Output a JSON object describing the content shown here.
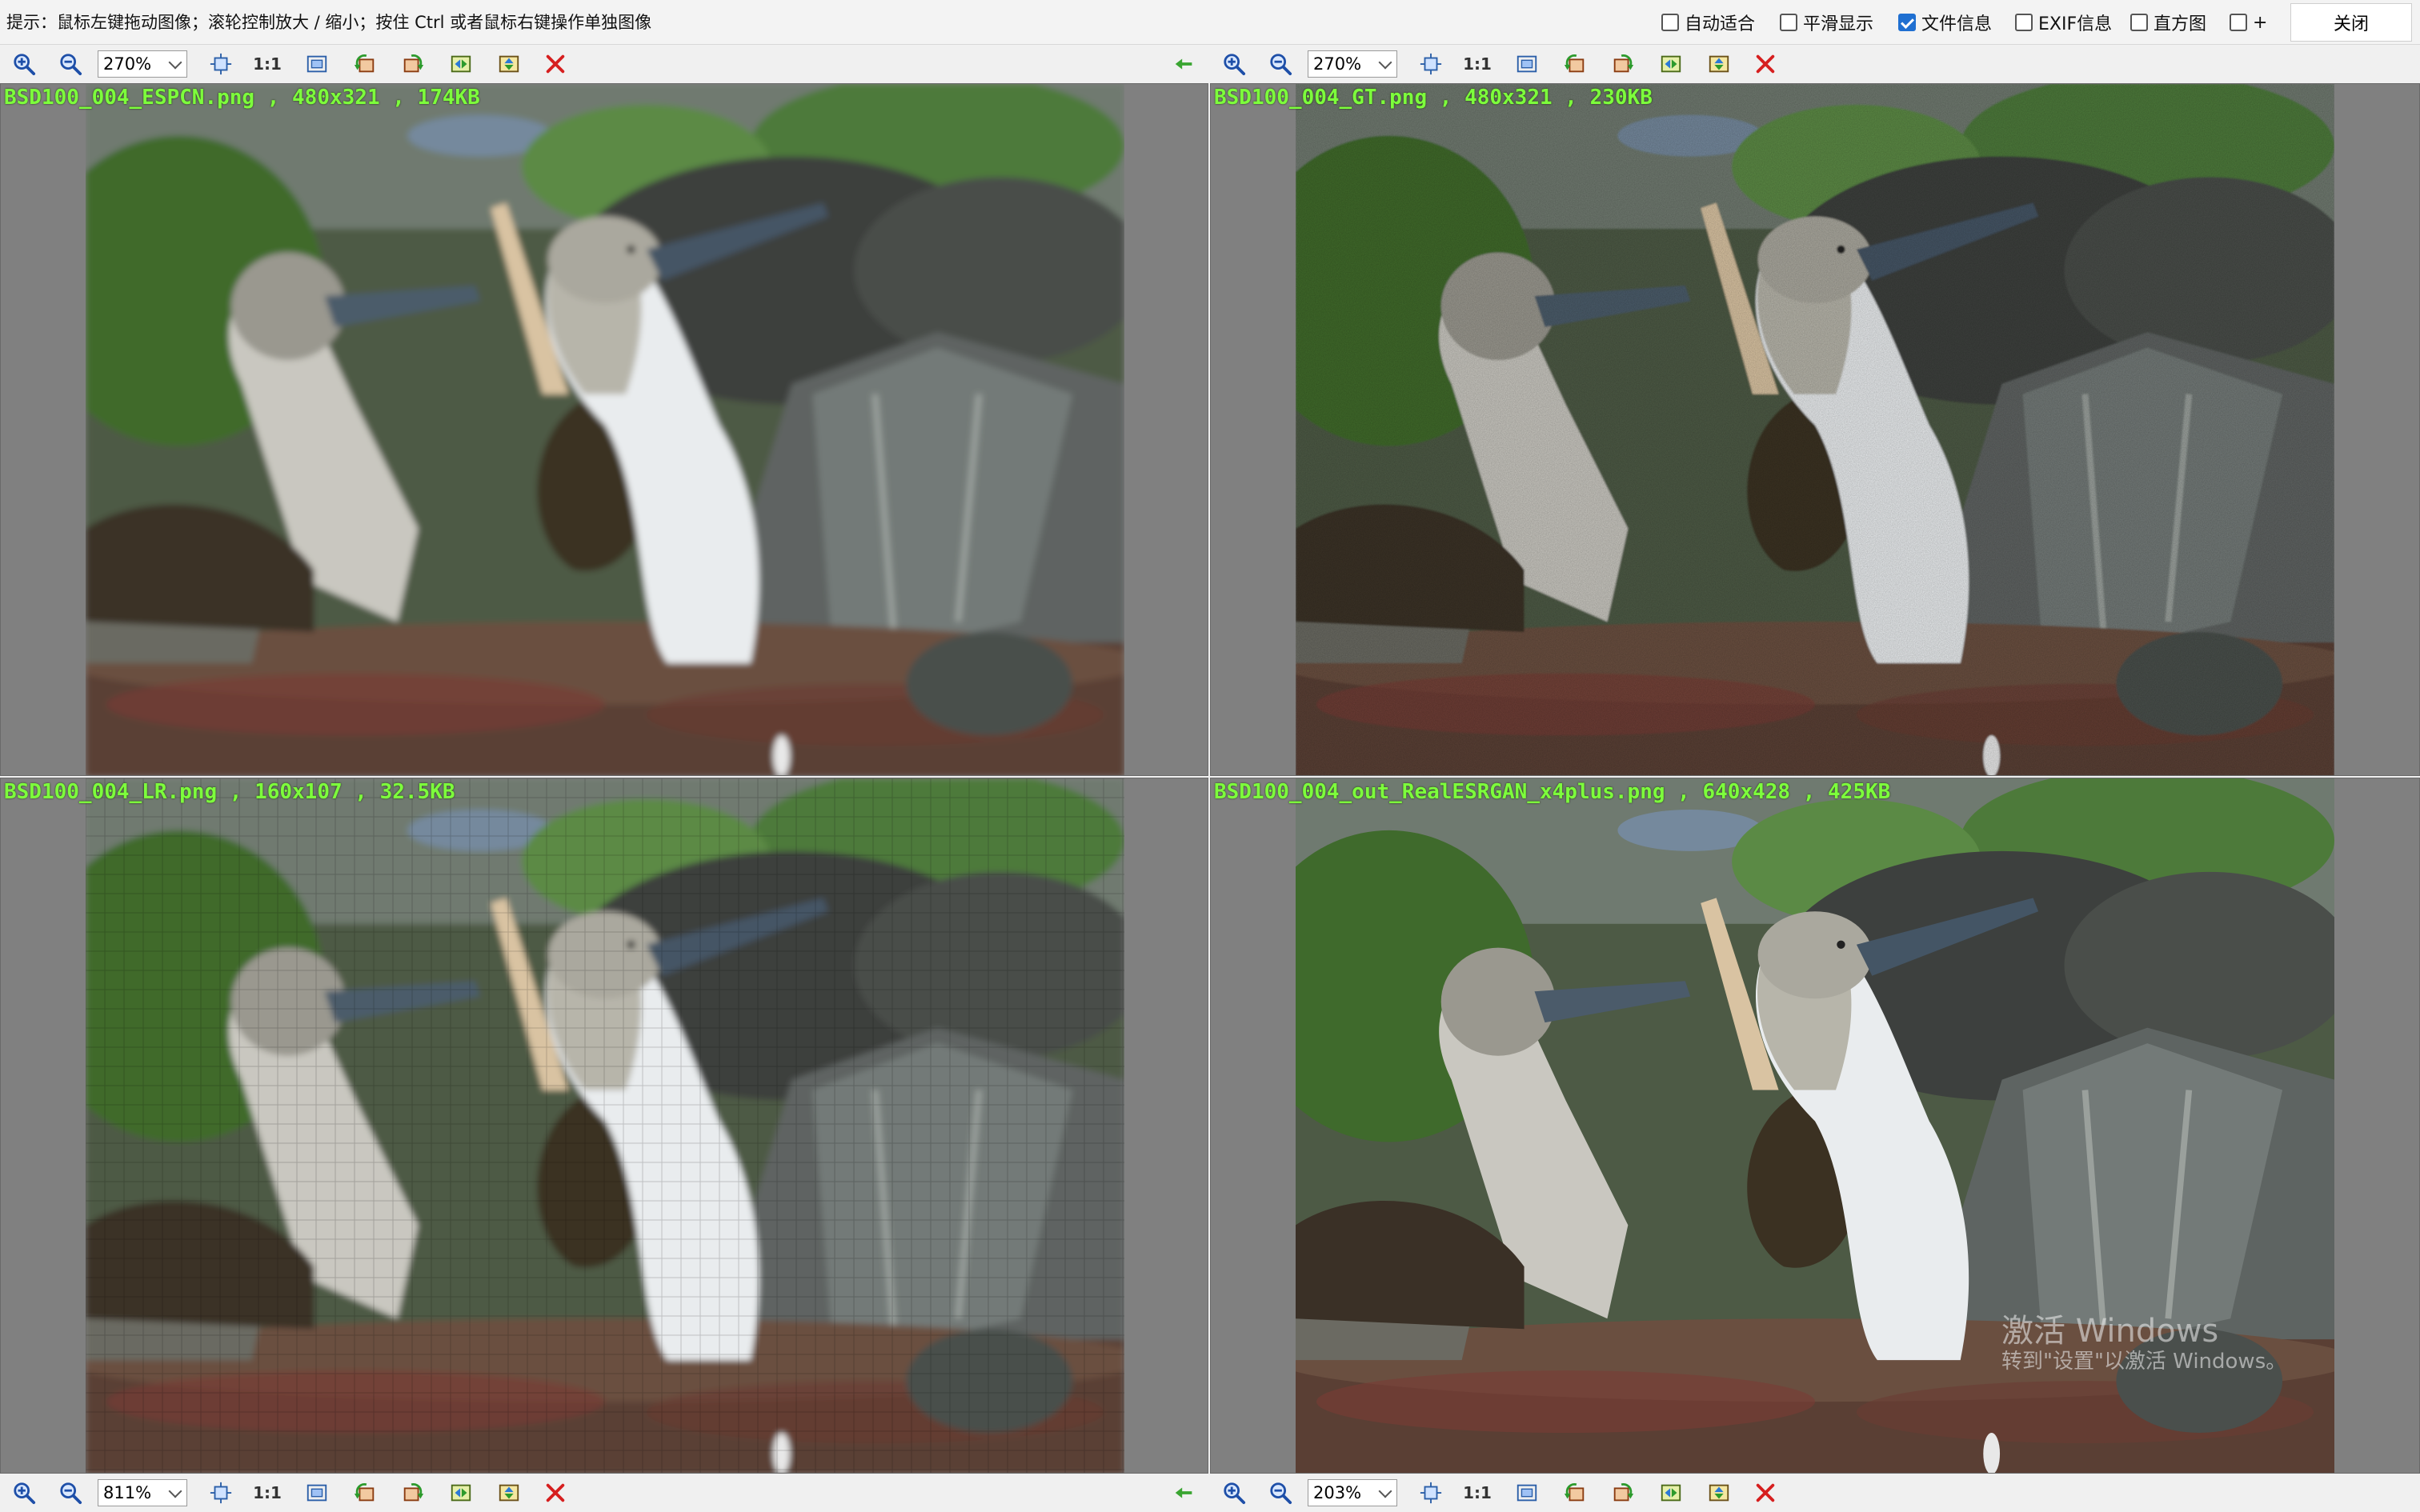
{
  "hint": "提示：鼠标左键拖动图像；滚轮控制放大 / 缩小；按住 Ctrl 或者鼠标右键操作单独图像",
  "options": [
    {
      "label": "自动适合",
      "checked": false
    },
    {
      "label": "平滑显示",
      "checked": false
    },
    {
      "label": "文件信息",
      "checked": true
    },
    {
      "label": "EXIF信息",
      "checked": false
    },
    {
      "label": "直方图",
      "checked": false
    },
    {
      "label": "+",
      "checked": false
    }
  ],
  "close_label": "关闭",
  "toolbar_one_to_one": "1:1",
  "toolbars": {
    "top_left": {
      "zoom": "270%"
    },
    "top_right": {
      "zoom": "270%"
    },
    "bottom_left": {
      "zoom": "811%"
    },
    "bottom_right": {
      "zoom": "203%"
    }
  },
  "panels": [
    {
      "caption": "BSD100_004_ESPCN.png , 480x321 , 174KB",
      "variant": "smooth"
    },
    {
      "caption": "BSD100_004_GT.png , 480x321 , 230KB",
      "variant": "sharp"
    },
    {
      "caption": "BSD100_004_LR.png , 160x107 , 32.5KB",
      "variant": "pixelated"
    },
    {
      "caption": "BSD100_004_out_RealESRGAN_x4plus.png , 640x428 , 425KB",
      "variant": "sharp"
    }
  ],
  "watermark": {
    "line1": "激活 Windows",
    "line2": "转到\"设置\"以激活 Windows。"
  },
  "colors": {
    "caption": "#7dff3c",
    "panel_bg": "#808080",
    "close_x": "#d61f1f",
    "arrow": "#3aa531"
  }
}
